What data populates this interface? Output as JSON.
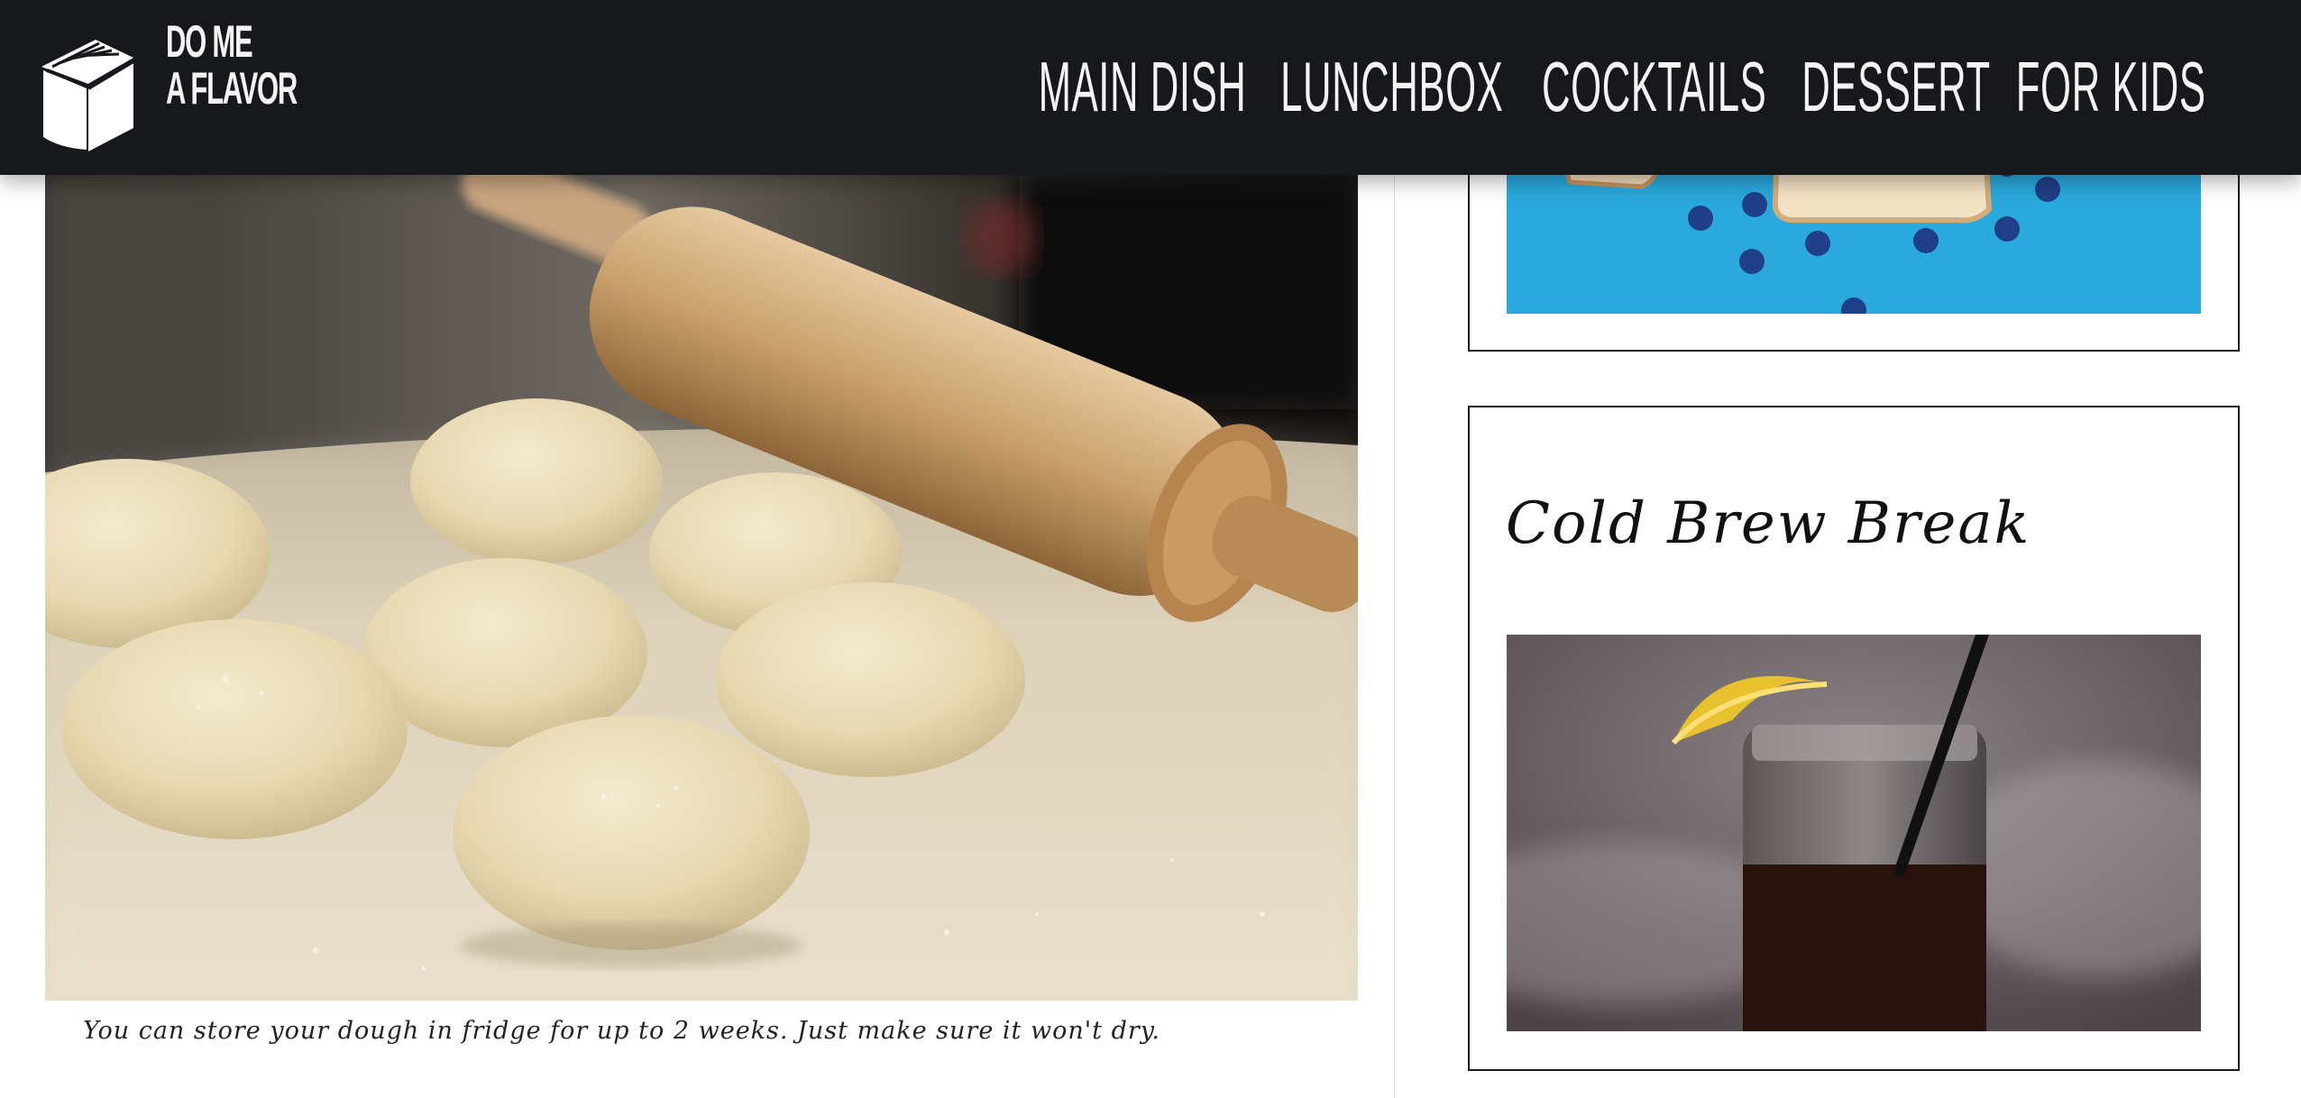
{
  "header": {
    "logo": {
      "line1": "DO ME",
      "line2": "A FLAVOR",
      "icon": "book-icon"
    },
    "nav": [
      "MAIN DISH",
      "LUNCHBOX",
      "COCKTAILS",
      "DESSERT",
      "FOR KIDS"
    ]
  },
  "main": {
    "photo_subject": "dough-balls-rolling-pin",
    "caption": "You can store your dough in fridge for up to 2 weeks. Just make sure it won't dry."
  },
  "sidebar": {
    "cards": [
      {
        "title": "",
        "photo_subject": "bread-and-blueberries"
      },
      {
        "title": "Cold Brew Break",
        "photo_subject": "iced-cold-brew-jar"
      }
    ]
  },
  "colors": {
    "header_bg": "#17181c",
    "nav_text": "#f4f4f4",
    "card_border": "#1a1a1a",
    "blue_surface": "#2aa9dd"
  }
}
